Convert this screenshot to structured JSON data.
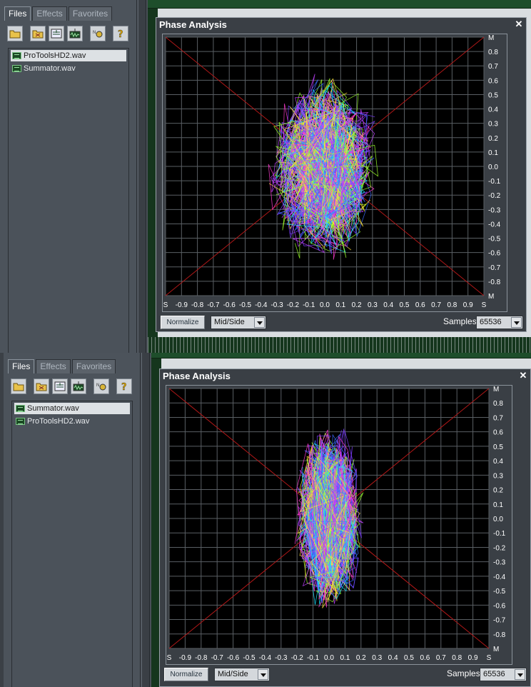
{
  "panels": [
    {
      "tabs": [
        "Files",
        "Effects",
        "Favorites"
      ],
      "files": [
        "ProToolsHD2.wav",
        "Summator.wav"
      ],
      "selected_file": "ProToolsHD2.wav",
      "window_title": "Phase Analysis",
      "normalize_label": "Normalize",
      "mode_value": "Mid/Side",
      "samples_label": "Samples",
      "samples_value": "65536"
    },
    {
      "tabs": [
        "Files",
        "Effects",
        "Favorites"
      ],
      "files": [
        "Summator.wav",
        "ProToolsHD2.wav"
      ],
      "selected_file": "Summator.wav",
      "window_title": "Phase Analysis",
      "normalize_label": "Normalize",
      "mode_value": "Mid/Side",
      "samples_label": "Samples",
      "samples_value": "65536"
    }
  ],
  "scope": {
    "x_ticks": [
      "S",
      "-0.9",
      "-0.8",
      "-0.7",
      "-0.6",
      "-0.5",
      "-0.4",
      "-0.3",
      "-0.2",
      "-0.1",
      "0.0",
      "0.1",
      "0.2",
      "0.3",
      "0.4",
      "0.5",
      "0.6",
      "0.7",
      "0.8",
      "0.9",
      "S"
    ],
    "y_ticks": [
      "M",
      "0.8",
      "0.7",
      "0.6",
      "0.5",
      "0.4",
      "0.3",
      "0.2",
      "0.1",
      "0.0",
      "-0.1",
      "-0.2",
      "-0.3",
      "-0.4",
      "-0.5",
      "-0.6",
      "-0.7",
      "-0.8",
      "M"
    ],
    "trace_colors": [
      "#7b3cff",
      "#ff3bd0",
      "#3a6bff",
      "#19e0ff",
      "#9bff2a",
      "#ffe23a",
      "#c040ff"
    ],
    "scatter_spread": [
      0.42,
      0.25
    ]
  }
}
